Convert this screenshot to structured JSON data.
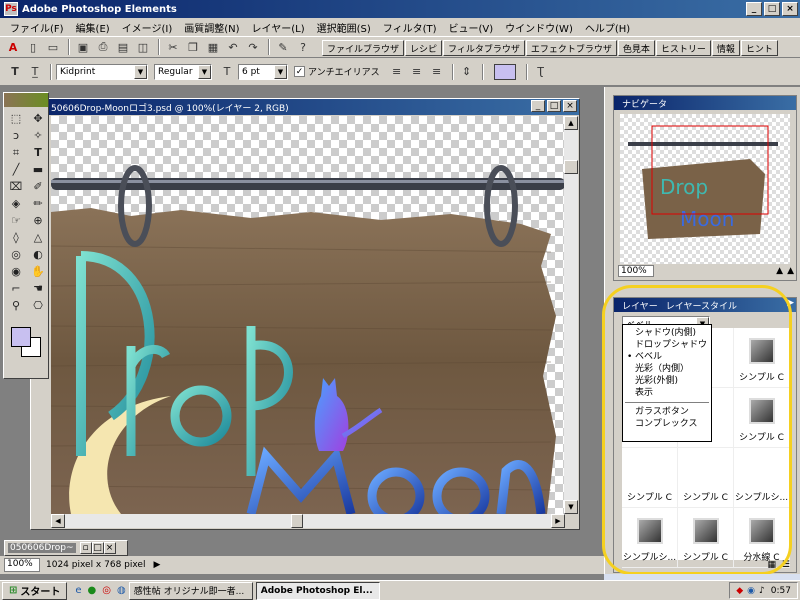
{
  "window": {
    "title": "Adobe Photoshop Elements"
  },
  "menu": [
    "ファイル(F)",
    "編集(E)",
    "イメージ(I)",
    "画質調整(N)",
    "レイヤー(L)",
    "選択範囲(S)",
    "フィルタ(T)",
    "ビュー(V)",
    "ウインドウ(W)",
    "ヘルプ(H)"
  ],
  "palette_well": [
    "ファイルブラウザ",
    "レシピ",
    "フィルタブラウザ",
    "エフェクトブラウザ",
    "色見本",
    "ヒストリー",
    "情報",
    "ヒント"
  ],
  "options": {
    "font": "Kidprint",
    "style": "Regular",
    "size": "6 pt",
    "antialias_label": "アンチエイリアス",
    "antialias_checked": true,
    "color": "#c8c0f0"
  },
  "document": {
    "title": "50606Drop-Moonロゴ3.psd @ 100%(レイヤー 2, RGB)",
    "minimized_title": "050606Drop~"
  },
  "status": {
    "zoom": "100%",
    "size": "1024 pixel x 768 pixel"
  },
  "navigator": {
    "tab": "ナビゲータ",
    "zoom": "100%"
  },
  "layer_styles": {
    "tabs": [
      "レイヤー",
      "レイヤースタイル"
    ],
    "selected_category": "ベベル",
    "categories": [
      "シャドウ(内側)",
      "ドロップシャドウ",
      "ベベル",
      "光彩（内側）",
      "光彩(外側)",
      "表示",
      "ガラスボタン",
      "コンプレックス"
    ],
    "checked_category": "ベベル",
    "items": [
      "シンプル C",
      "シンプル C",
      "シンプル C",
      "シンプル C",
      "シンプルシ...",
      "シンプルシ...",
      "シンプル C",
      "分水線 C"
    ]
  },
  "taskbar": {
    "start": "スタート",
    "tasks": [
      "感性帖 オリジナル即一者...",
      "Adobe Photoshop El..."
    ],
    "active_task": 1,
    "clock": "0:57"
  },
  "colors": {
    "title_blue": "#0a246a",
    "highlight_yellow": "#f5d020",
    "wood": "#7a6248"
  }
}
